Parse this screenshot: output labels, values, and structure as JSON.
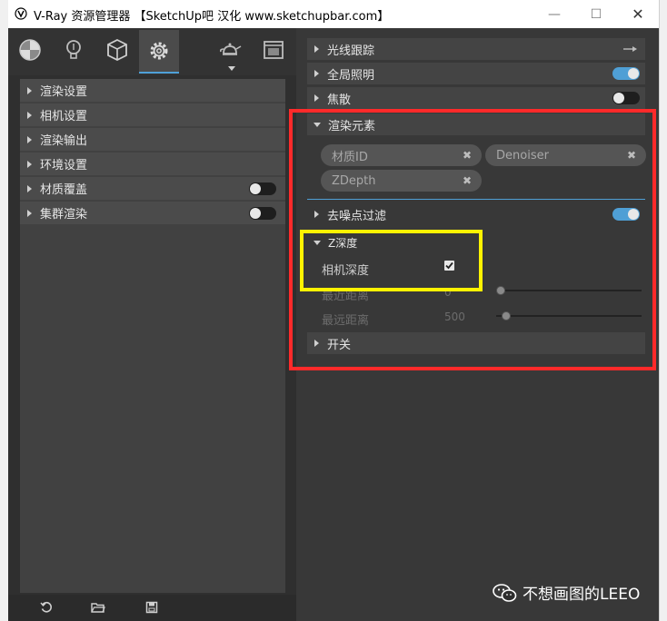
{
  "window": {
    "title": "V-Ray 资源管理器 【SketchUp吧 汉化 www.sketchupbar.com】"
  },
  "toolbar": {
    "tools": [
      "materials-icon",
      "lights-icon",
      "geometry-icon",
      "settings-icon",
      "teapot-icon",
      "frame-buffer-icon"
    ]
  },
  "left_categories": [
    {
      "label": "渲染设置"
    },
    {
      "label": "相机设置"
    },
    {
      "label": "渲染输出"
    },
    {
      "label": "环境设置"
    },
    {
      "label": "材质覆盖",
      "toggle": "off"
    },
    {
      "label": "集群渲染",
      "toggle": "off"
    }
  ],
  "bottom_buttons": [
    "reset-icon",
    "open-folder-icon",
    "save-icon"
  ],
  "right_sections": {
    "raytrace": {
      "label": "光线跟踪"
    },
    "gi": {
      "label": "全局照明",
      "toggle": "on"
    },
    "caustics": {
      "label": "焦散",
      "toggle": "off"
    },
    "render_elements": {
      "label": "渲染元素"
    },
    "denoiser": {
      "label": "去噪点过滤",
      "toggle": "on"
    },
    "zdepth": {
      "label": "Z深度"
    },
    "switch": {
      "label": "开关"
    }
  },
  "render_element_chips": [
    {
      "label": "材质ID"
    },
    {
      "label": "Denoiser"
    },
    {
      "label": "ZDepth"
    }
  ],
  "zdepth_props": {
    "camera_depth": {
      "label": "相机深度",
      "checked": true
    },
    "near": {
      "label": "最近距离",
      "value": "0"
    },
    "far": {
      "label": "最远距离",
      "value": "500"
    }
  },
  "watermark": {
    "text": "不想画图的LEEO"
  },
  "colors": {
    "accent": "#4f9fd5",
    "red_box": "#ff2a2a",
    "yellow_box": "#fff200"
  }
}
